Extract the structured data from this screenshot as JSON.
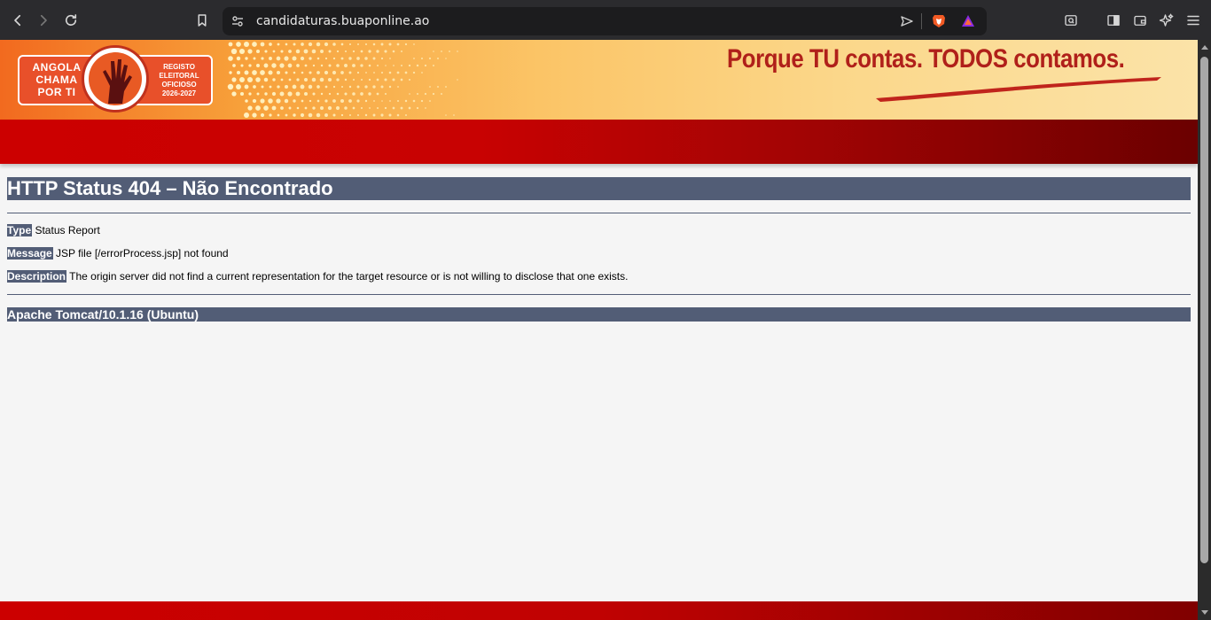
{
  "browser": {
    "url": "candidaturas.buaponline.ao",
    "icons": [
      "back-icon",
      "forward-icon",
      "reload-icon",
      "bookmark-icon",
      "site-settings-icon",
      "send-icon",
      "brave-shields-icon",
      "brave-rewards-icon",
      "search-tab-icon",
      "sidebar-icon",
      "wallet-icon",
      "leo-ai-icon",
      "menu-icon"
    ]
  },
  "banner": {
    "logo_left": "ANGOLA CHAMA POR TI",
    "logo_right": "REGISTO ELEITORAL OFICIOSO 2026-2027",
    "slogan": "Porque TU contas. TODOS contamos.",
    "colors": {
      "accent_red": "#cc0000",
      "dark_red": "#6b0000",
      "banner_orange": "#f7a03a"
    }
  },
  "error": {
    "title": "HTTP Status 404 – Não Encontrado",
    "type_label": "Type",
    "type_value": "Status Report",
    "message_label": "Message",
    "message_value": "JSP file [/errorProcess.jsp] not found",
    "description_label": "Description",
    "description_value": "The origin server did not find a current representation for the target resource or is not willing to disclose that one exists.",
    "server": "Apache Tomcat/10.1.16 (Ubuntu)",
    "header_color": "#525d76"
  }
}
